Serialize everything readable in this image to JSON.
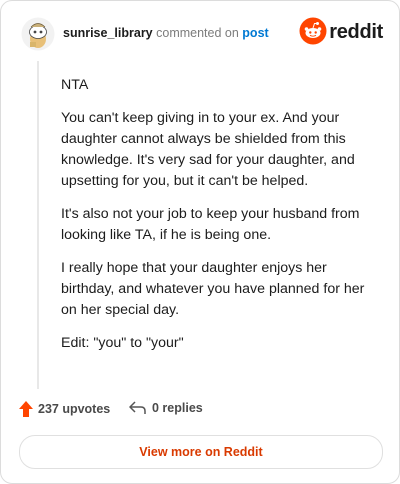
{
  "header": {
    "username": "sunrise_library",
    "action_text": "commented on",
    "post_link": "post",
    "brand": "reddit"
  },
  "comment": {
    "paragraphs": [
      "NTA",
      "You can't keep giving in to your ex. And your daughter cannot always be shielded from this knowledge. It's very sad for your daughter, and upsetting for you, but it can't be helped.",
      "It's also not your job to keep your husband from looking like TA, if he is being one.",
      "I really hope that your daughter enjoys her birthday, and whatever you have planned for her on her special day.",
      "Edit: \"you\" to \"your\""
    ]
  },
  "footer": {
    "upvotes": "237 upvotes",
    "replies": "0 replies"
  },
  "cta": {
    "label": "View more on Reddit"
  },
  "colors": {
    "brand": "#ff4500",
    "link": "#0079d3",
    "cta_text": "#d93a00"
  }
}
